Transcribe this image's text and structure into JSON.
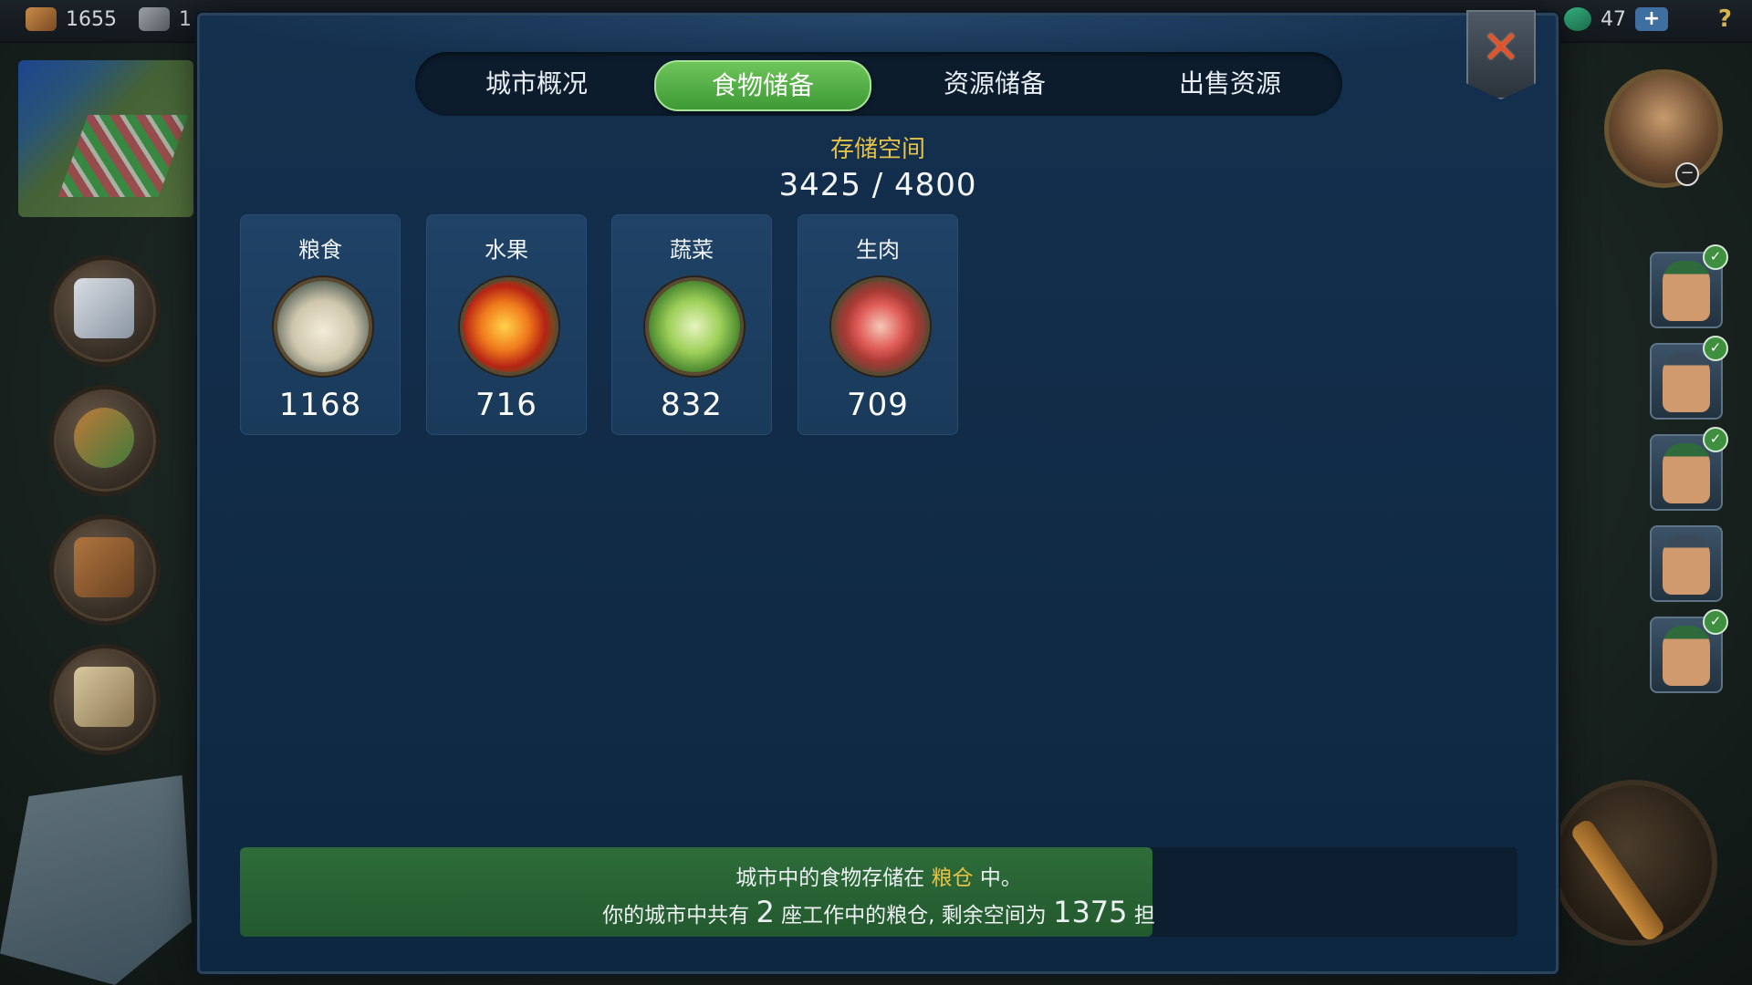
{
  "topbar": {
    "wood_amount": "1655",
    "stone_amount": "1",
    "gems_amount": "47",
    "plus_label": "+",
    "help_label": "?"
  },
  "dialog": {
    "tabs": [
      {
        "label": "城市概况",
        "active": false
      },
      {
        "label": "食物储备",
        "active": true
      },
      {
        "label": "资源储备",
        "active": false
      },
      {
        "label": "出售资源",
        "active": false
      }
    ],
    "close_label": "✕",
    "storage": {
      "title": "存储空间",
      "value": "3425 / 4800",
      "used": 3425,
      "capacity": 4800
    },
    "items": [
      {
        "name": "粮食",
        "amount": "1168",
        "icon": "grain-sack-icon"
      },
      {
        "name": "水果",
        "amount": "716",
        "icon": "apple-icon"
      },
      {
        "name": "蔬菜",
        "amount": "832",
        "icon": "cabbage-icon"
      },
      {
        "name": "生肉",
        "amount": "709",
        "icon": "raw-meat-icon"
      }
    ],
    "info": {
      "line1_prefix": "城市中的食物存储在",
      "line1_highlight": "粮仓",
      "line1_suffix": "中。",
      "line2_a": "你的城市中共有",
      "granary_count": "2",
      "line2_b": "座工作中的粮仓, 剩余空间为",
      "remaining": "1375",
      "line2_c": "担"
    }
  },
  "colors": {
    "accent_green": "#4faa42",
    "highlight_yellow": "#e6c247",
    "panel_blue": "#14304e"
  }
}
